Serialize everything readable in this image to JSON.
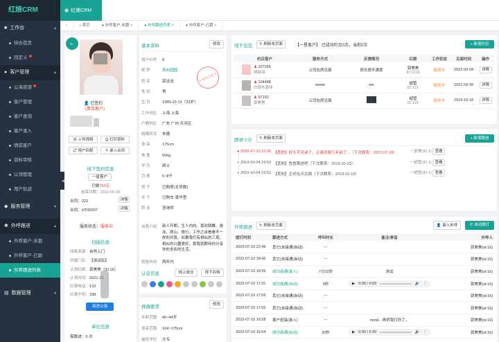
{
  "app": {
    "title": "红娘CRM",
    "brand_label": "红娘CRM"
  },
  "sidebar": {
    "groups": [
      {
        "label": "工作台",
        "items": [
          "待办首页",
          "回定义"
        ]
      },
      {
        "label": "客户管理",
        "items": [
          "公海资源",
          "客户管理",
          "客户查询",
          "客户录入",
          "情前客户",
          "资料审核",
          "认领管理",
          "用户轨迹"
        ]
      },
      {
        "label": "服务管理",
        "items": []
      },
      {
        "label": "外呼跟进",
        "items": [
          "外呼客户-未跟",
          "外呼客户-已跟",
          "外呼跟进列表"
        ]
      },
      {
        "label": "数据管理",
        "items": []
      }
    ]
  },
  "tabs": [
    "首页",
    "外呼客户-未跟",
    "外呼跟进列表",
    "外呼客户-已跟"
  ],
  "profile": {
    "signed": "已签约",
    "branch": "(青岛客户)",
    "btn_upload": "上传视频",
    "btn_print": "打印资料",
    "btn_match": "用户匹配",
    "btn_enter": "录入合同",
    "offline_title": "线下签约信息",
    "level": "一星客户",
    "paid_prefix": "已缴",
    "paid_amount": "792元",
    "end_prefix": "结束日期：",
    "end_date": "2022-09-18",
    "contract1_label": "合同：",
    "contract1": "222",
    "contract2_label": "合同：",
    "contract2": "HT00007",
    "detail": "详情",
    "service_label": "服务状态：",
    "service_status": "服务中",
    "scan_title": "扫描信息",
    "scan_rows": [
      [
        "线索来源：",
        "自然上门"
      ],
      [
        "所属门店：",
        "【测试店】"
      ],
      [
        "认领红娘：",
        "郭美美（ID:16）"
      ],
      [
        "认领时间：",
        "2021-10"
      ],
      [
        "红娘电话：",
        "133"
      ],
      [
        "红娘手机：",
        "188"
      ]
    ],
    "to_pool": "到进公海",
    "reg_title": "单位信息",
    "reg_count_label": "需跟进：",
    "reg_count": "0 次"
  },
  "basic": {
    "title": "基本资料",
    "edit": "修改",
    "rows": [
      [
        "用户ID号",
        "8"
      ],
      [
        "昵 称",
        "扬州园园"
      ],
      [
        "姓 名",
        "郭洁洁"
      ],
      [
        "性 别",
        "男"
      ],
      [
        "生 日",
        "1989-10-13（33岁）"
      ],
      [
        "工作地区",
        "上海 上海"
      ],
      [
        "户籍地区",
        "广东 广州 天河区"
      ],
      [
        "婚姻状况",
        "未婚"
      ],
      [
        "身 高",
        "175cm"
      ],
      [
        "体 重",
        "50kg"
      ],
      [
        "学 历",
        "硕士"
      ],
      [
        "月 薪",
        "5~8千"
      ],
      [
        "房 子",
        "已购房(无贷款)"
      ],
      [
        "车 子",
        "已购车-豪华型"
      ],
      [
        "职 业",
        "咨询师"
      ]
    ],
    "selfdesc_label": "自我介绍",
    "selfdesc": "新人开朗，生人内向。喜欢跳舞、游泳、爬山、旅行，工作之余看看不一样的风景。如果我们有相似的三观，相似的兴趣爱好，那我就期待你分享你的多彩的生活。",
    "region_label": "销售时间",
    "region": "两年内",
    "auth_title": "认证信息",
    "auth_btn1": "线上成交",
    "auth_btn2": "线下存档",
    "spouse_title": "择偶要求",
    "spouse_edit": "修改",
    "spouse_rows": [
      [
        "年龄范围",
        "40~44岁"
      ],
      [
        "身高范围",
        "164~175cm"
      ],
      [
        "最低学历",
        "大专"
      ]
    ]
  },
  "offline": {
    "title": "线下见见",
    "refresh": "刷新本页面",
    "summary_prefix": "【一星客户】 已成功约见",
    "summary_success": "0",
    "summary_mid": "次，当前",
    "summary_cur": "0",
    "summary_suffix": "次",
    "new_btn": "+ 新增约见",
    "headers": [
      "约见客户",
      "服务方式",
      "反馈情况",
      "红娘",
      "工作状态",
      "见面时间",
      "操作"
    ],
    "rows": [
      {
        "id": "107265",
        "name": "胡丽丽",
        "mode": "公司包房见面",
        "feedback": "很长很不满意",
        "hn": "郭美美",
        "hn_id": "ID:1216",
        "status": "服务中",
        "date": "2022-03-04",
        "op": "详情"
      },
      {
        "id": "104488",
        "name": "白银东香味",
        "mode": "wewe",
        "feedback": "we",
        "hn": "超管",
        "hn_id": "ID:121",
        "status": "服务中",
        "date": "2021-03-30",
        "op": "详情"
      },
      {
        "id": "97192",
        "name": "郭美美",
        "mode": "公司包房见面",
        "feedback": "",
        "hn": "超管",
        "hn_id": "ID:121",
        "status": "服务中",
        "date": "2019-10-18",
        "op": "详情"
      }
    ]
  },
  "followup": {
    "title": "跟进小计",
    "refresh": "刷新本页面",
    "new_btn": "+ 新增跟进",
    "items": [
      {
        "time": "2020-07-10 22:36",
        "text": "【其他】好久不见迷了，让谁还是几年前了...（下次联系：2023-07-28）",
        "who": "一郭美(ID:1)",
        "op": "查看",
        "hl": true
      },
      {
        "time": "2019-10-04 19:52",
        "text": "【其他】鱼鱼跟进吧（下次联系：2019-10-23）",
        "who": "一超管(ID:1)",
        "op": "查看",
        "hl": false
      },
      {
        "time": "2019-10-04 19:51",
        "text": "【其他】正好在天见面（下次联系：2019-10-19）",
        "who": "一超管(ID:1)",
        "op": "查看",
        "hl": false
      }
    ]
  },
  "outbound": {
    "title": "外呼跟进",
    "refresh": "刷新本页面",
    "enter_btn": "录入外呼",
    "auto_btn": "自动拨打",
    "headers": [
      "拨打时间",
      "跟进方式",
      "呼叫时长",
      "备注/录音",
      "外呼人"
    ],
    "rows": [
      {
        "time": "2023-07-10 22:49",
        "mode": "其它(未接通(自动)",
        "dur": "---",
        "note": "",
        "who": "郭美美(id:16)"
      },
      {
        "time": "2023-07-10 18:42",
        "mode": "其它(未接通(自动)",
        "dur": "---",
        "note": "",
        "who": "郭美美(id:16)"
      },
      {
        "time": "2023-07-10 18:39",
        "mode": "成功接通(录入)",
        "dur": "7分22秒",
        "note": "测试",
        "who": "郭美美(id:16)"
      },
      {
        "time": "2023-07-10 17:31",
        "mode": "成功接通(自动)",
        "dur": "9秒",
        "note": "0:00 / 0:09",
        "who": "郭美美(id:16)"
      },
      {
        "time": "2023-07-10 17:09",
        "mode": "其它(未接通(自动)",
        "dur": "---",
        "note": "",
        "who": "郭美美(id:16)"
      },
      {
        "time": "2023-07-10 17:02",
        "mode": "其它(未接通(自动)",
        "dur": "---",
        "note": "",
        "who": "郭美美(id:16)"
      },
      {
        "time": "2023-07-10 16:58",
        "mode": "客户拒接(录入)",
        "dur": "---",
        "note": "mmd，再挤我打你了。",
        "who": "郭美美(id:16)"
      },
      {
        "time": "2023-07-10 16:54",
        "mode": "成功接通(自动)",
        "dur": "20秒",
        "note": "0:00 / 0:20",
        "who": "郭美美(id:16)"
      }
    ]
  }
}
